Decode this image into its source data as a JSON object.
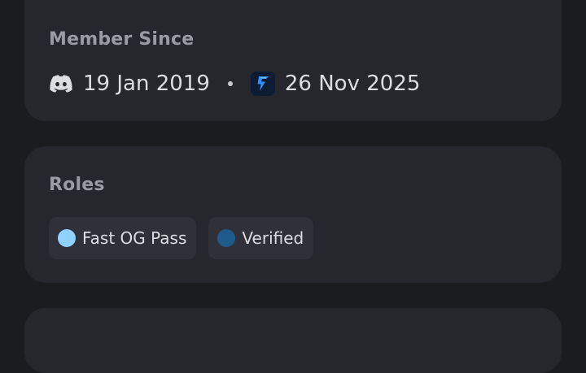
{
  "member_since": {
    "title": "Member Since",
    "discord_date": "19 Jan 2019",
    "server_date": "26 Nov 2025",
    "discord_icon": "discord-icon",
    "server_icon": "lightning-server-icon"
  },
  "roles": {
    "title": "Roles",
    "items": [
      {
        "label": "Fast OG Pass",
        "color": "#8fd1ff"
      },
      {
        "label": "Verified",
        "color": "#1e5a8a"
      }
    ]
  }
}
